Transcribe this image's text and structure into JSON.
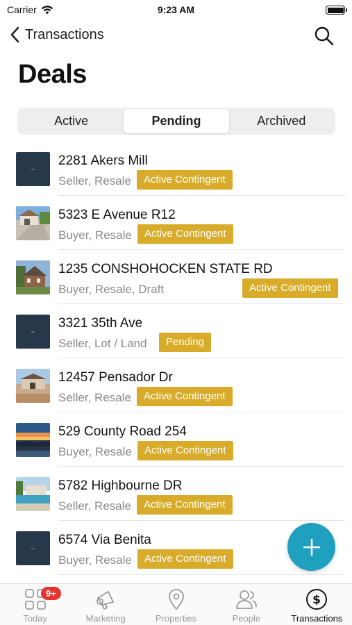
{
  "status_bar": {
    "carrier": "Carrier",
    "time": "9:23 AM"
  },
  "nav": {
    "back_label": "Transactions"
  },
  "page_title": "Deals",
  "segments": [
    {
      "label": "Active",
      "selected": false
    },
    {
      "label": "Pending",
      "selected": true
    },
    {
      "label": "Archived",
      "selected": false
    }
  ],
  "deals": [
    {
      "title": "2281  Akers Mill",
      "subtitle": "Seller, Resale",
      "status": "Active Contingent",
      "image": "placeholder"
    },
    {
      "title": "5323 E Avenue R12",
      "subtitle": "Buyer, Resale",
      "status": "Active Contingent",
      "image": "house-photo"
    },
    {
      "title": "1235 CONSHOHOCKEN STATE RD",
      "subtitle": "Buyer, Resale, Draft",
      "status": "Active Contingent",
      "image": "house-photo"
    },
    {
      "title": "3321  35th Ave",
      "subtitle": "Seller, Lot / Land",
      "status": "Pending",
      "image": "placeholder"
    },
    {
      "title": "12457 Pensador Dr",
      "subtitle": "Seller, Resale",
      "status": "Active Contingent",
      "image": "house-photo"
    },
    {
      "title": "529 County Road 254",
      "subtitle": "Buyer, Resale",
      "status": "Active Contingent",
      "image": "sunset-photo"
    },
    {
      "title": "5782 Highbourne DR",
      "subtitle": "Seller, Resale",
      "status": "Active Contingent",
      "image": "pool-photo"
    },
    {
      "title": "6574 Via Benita",
      "subtitle": "Buyer, Resale",
      "status": "Active Contingent",
      "image": "placeholder"
    }
  ],
  "tabs": [
    {
      "label": "Today",
      "icon": "grid-icon",
      "badge": "9+",
      "active": false
    },
    {
      "label": "Marketing",
      "icon": "megaphone-icon",
      "active": false
    },
    {
      "label": "Properties",
      "icon": "location-pin-icon",
      "active": false
    },
    {
      "label": "People",
      "icon": "people-icon",
      "active": false
    },
    {
      "label": "Transactions",
      "icon": "dollar-circle-icon",
      "active": true
    }
  ],
  "colors": {
    "badge_gold": "#d8ac2a",
    "fab_teal": "#1fa0bf",
    "notif_red": "#e8322f"
  }
}
